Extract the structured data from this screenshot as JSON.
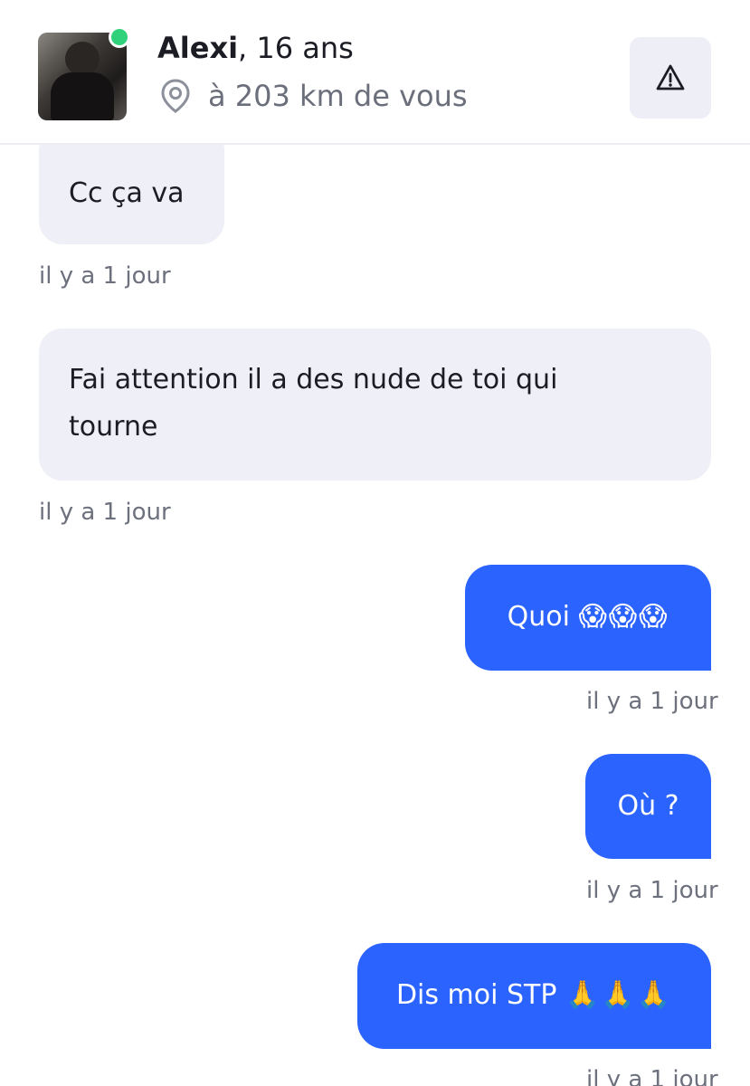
{
  "header": {
    "name": "Alexi",
    "age": ", 16 ans",
    "location": "à 203 km de vous",
    "status": "online",
    "report_icon": "warning-triangle-icon",
    "location_icon": "map-pin-icon"
  },
  "colors": {
    "accent": "#2b63ff",
    "incoming_bubble": "#efeff7",
    "online": "#2fd27a"
  },
  "messages": [
    {
      "direction": "incoming",
      "text": "Cc ça va",
      "time": "il y a 1 jour"
    },
    {
      "direction": "incoming",
      "text_line1": "Fai attention il a des nude de toi qui",
      "text_line2": "tourne",
      "time": "il y a 1 jour"
    },
    {
      "direction": "outgoing",
      "text": "Quoi",
      "emoji": "😱😱😱",
      "time": "il y a 1 jour"
    },
    {
      "direction": "outgoing",
      "text": "Où ?",
      "time": "il y a 1 jour"
    },
    {
      "direction": "outgoing",
      "text": "Dis moi STP",
      "emoji": "🙏🙏🙏",
      "time": "il y a 1 jour"
    }
  ]
}
